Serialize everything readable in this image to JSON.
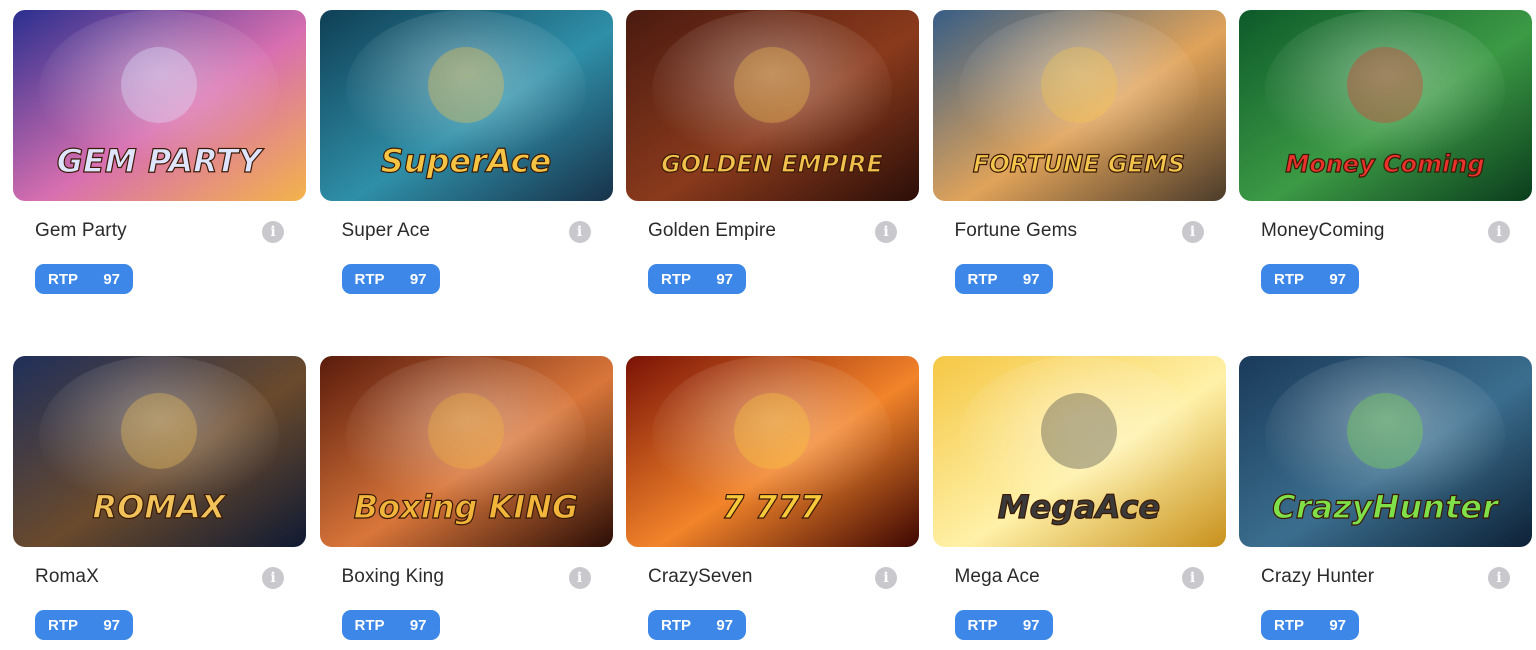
{
  "games": [
    {
      "name": "Gem Party",
      "logo_text": "GEM PARTY",
      "rtp_label": "RTP",
      "rtp_value": "97",
      "colors": [
        "#2a2f8f",
        "#d86fb0",
        "#f3b34a"
      ],
      "logo_color": "#dfe4ff"
    },
    {
      "name": "Super Ace",
      "logo_text": "SuperAce",
      "rtp_label": "RTP",
      "rtp_value": "97",
      "colors": [
        "#0f3f55",
        "#2f8fa8",
        "#17324a"
      ],
      "logo_color": "#f6c445"
    },
    {
      "name": "Golden Empire",
      "logo_text": "GOLDEN EMPIRE",
      "rtp_label": "RTP",
      "rtp_value": "97",
      "colors": [
        "#4a1a10",
        "#8a3a1c",
        "#2b0e08"
      ],
      "logo_color": "#f2c04d"
    },
    {
      "name": "Fortune Gems",
      "logo_text": "FORTUNE GEMS",
      "rtp_label": "RTP",
      "rtp_value": "97",
      "colors": [
        "#365d86",
        "#e0a35a",
        "#4b3b2a"
      ],
      "logo_color": "#f4c54d"
    },
    {
      "name": "MoneyComing",
      "logo_text": "Money Coming",
      "rtp_label": "RTP",
      "rtp_value": "97",
      "colors": [
        "#0d5a2a",
        "#3c9a45",
        "#0a3d1c"
      ],
      "logo_color": "#e8322b"
    },
    {
      "name": "RomaX",
      "logo_text": "ROMAX",
      "rtp_label": "RTP",
      "rtp_value": "97",
      "colors": [
        "#1f2f5a",
        "#6a4a2c",
        "#0f1a33"
      ],
      "logo_color": "#f1c25a"
    },
    {
      "name": "Boxing King",
      "logo_text": "Boxing KING",
      "rtp_label": "RTP",
      "rtp_value": "97",
      "colors": [
        "#5a1b0c",
        "#d9763a",
        "#2a0d06"
      ],
      "logo_color": "#f2b53c"
    },
    {
      "name": "CrazySeven",
      "logo_text": "7 777",
      "rtp_label": "RTP",
      "rtp_value": "97",
      "colors": [
        "#7a1206",
        "#f2842a",
        "#3d0602"
      ],
      "logo_color": "#f8c93a"
    },
    {
      "name": "Mega Ace",
      "logo_text": "MegaAce",
      "rtp_label": "RTP",
      "rtp_value": "97",
      "colors": [
        "#f5c744",
        "#fff1a8",
        "#c8901c"
      ],
      "logo_color": "#3a3a3a"
    },
    {
      "name": "Crazy Hunter",
      "logo_text": "CrazyHunter",
      "rtp_label": "RTP",
      "rtp_value": "97",
      "colors": [
        "#1a3a5a",
        "#3b6e8e",
        "#0d2136"
      ],
      "logo_color": "#7fe04a"
    }
  ],
  "info_icon_glyph": "i"
}
